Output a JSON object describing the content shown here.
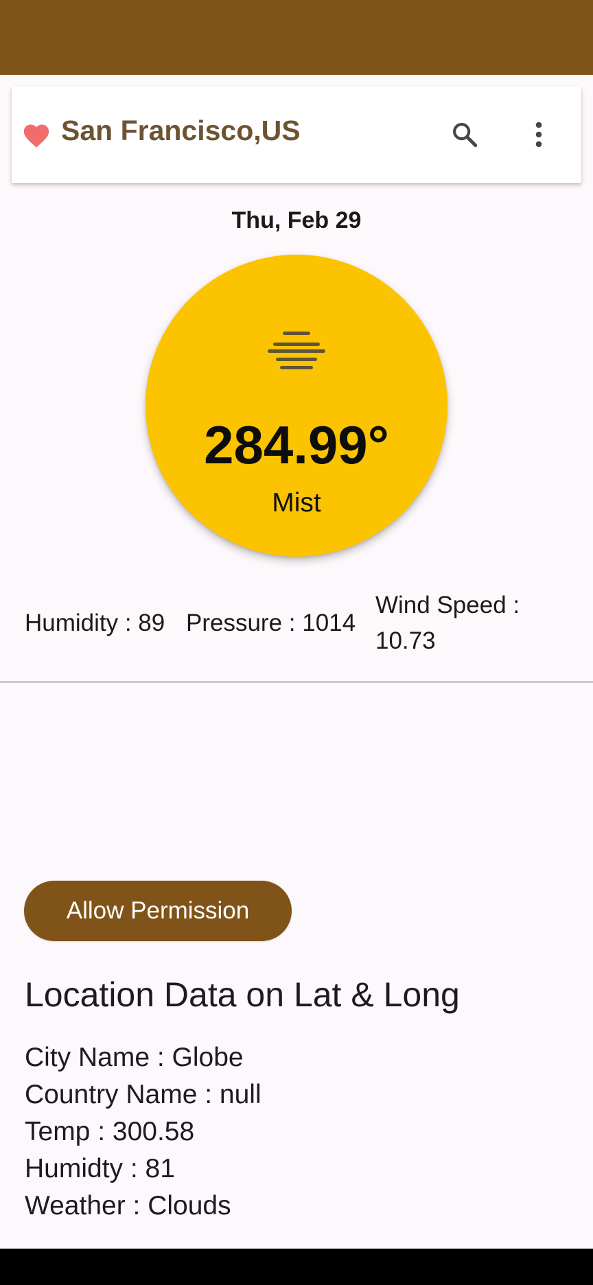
{
  "colors": {
    "primary": "#805418",
    "title": "#6c5433",
    "weather_circle": "#fbc300",
    "favorite": "#f26c6c",
    "background": "#fdf8fb"
  },
  "app_bar": {
    "title": "San Francisco,US",
    "favorite_icon": "heart-icon",
    "search_icon": "search-icon",
    "menu_icon": "more-vert-icon"
  },
  "weather": {
    "date": "Thu, Feb 29",
    "icon": "mist-icon",
    "temperature": "284.99°",
    "condition": "Mist"
  },
  "stats": {
    "humidity": "Humidity : 89",
    "pressure": "Pressure : 1014",
    "wind_line1": "Wind Speed :",
    "wind_line2": "10.73"
  },
  "permission": {
    "button_label": "Allow Permission"
  },
  "location": {
    "heading": "Location Data on Lat & Long",
    "city": "City Name : Globe",
    "country": "Country Name : null",
    "temp": "Temp : 300.58",
    "humidity": "Humidty : 81",
    "weather": "Weather : Clouds"
  }
}
